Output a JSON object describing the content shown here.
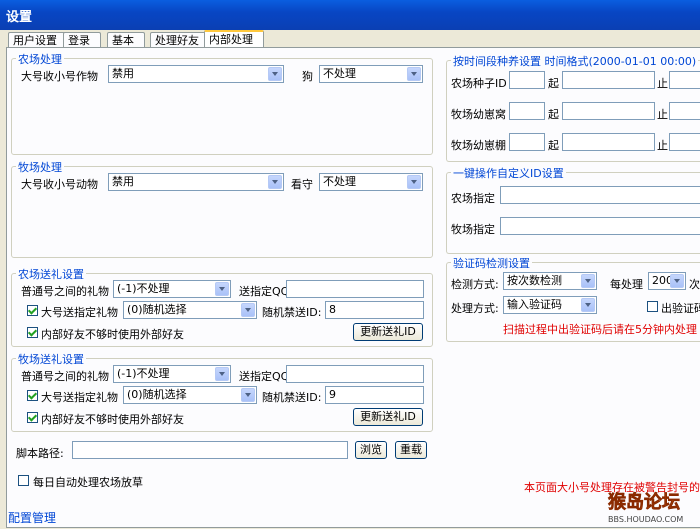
{
  "window": {
    "title": "设置"
  },
  "tabs": [
    "用户设置",
    "登录",
    "基本",
    "处理好友",
    "内部处理"
  ],
  "farm": {
    "title": "农场处理",
    "harvest_label": "大号收小号作物",
    "harvest_value": "禁用",
    "dog_label": "狗",
    "dog_value": "不处理"
  },
  "ranch": {
    "title": "牧场处理",
    "harvest_label": "大号收小号动物",
    "harvest_value": "禁用",
    "guard_label": "看守",
    "guard_value": "不处理"
  },
  "farm_gift": {
    "title": "农场送礼设置",
    "normal_label": "普通号之间的礼物",
    "normal_value": "(-1)不处理",
    "send_to_label": "送指定QQ",
    "send_to_value": "",
    "big_gift_label": "大号送指定礼物",
    "big_gift_value": "(0)随机选择",
    "random_ban_label": "随机禁送ID:",
    "random_ban_value": "8",
    "external_label": "内部好友不够时使用外部好友",
    "update_button": "更新送礼ID"
  },
  "ranch_gift": {
    "title": "牧场送礼设置",
    "normal_label": "普通号之间的礼物",
    "normal_value": "(-1)不处理",
    "send_to_label": "送指定QQ",
    "send_to_value": "",
    "big_gift_label": "大号送指定礼物",
    "big_gift_value": "(0)随机选择",
    "random_ban_label": "随机禁送ID:",
    "random_ban_value": "9",
    "external_label": "内部好友不够时使用外部好友",
    "update_button": "更新送礼ID"
  },
  "script": {
    "path_label": "脚本路径:",
    "path_value": "",
    "browse_button": "浏览",
    "reload_button": "重载"
  },
  "auto_grass": {
    "label": "每日自动处理农场放草"
  },
  "time_segment": {
    "title": "按时间段种养设置 时间格式(2000-01-01 00:00)",
    "rows": [
      {
        "label": "农场种子ID",
        "from": "起",
        "to": "止"
      },
      {
        "label": "牧场幼崽窝",
        "from": "起",
        "to": "止"
      },
      {
        "label": "牧场幼崽棚",
        "from": "起",
        "to": "止"
      }
    ]
  },
  "one_click": {
    "title": "一键操作自定义ID设置",
    "farm_label": "农场指定",
    "ranch_label": "牧场指定"
  },
  "captcha": {
    "title": "验证码检测设置",
    "detect_label": "检测方式:",
    "detect_value": "按次数检测",
    "per_label": "每处理",
    "per_value": "200",
    "per_unit": "次",
    "handle_label": "处理方式:",
    "handle_value": "输入验证码",
    "show_captcha_label": "出验证码",
    "warning": "扫描过程中出验证码后请在5分钟内处理"
  },
  "bottom_warning": "本页面大小号处理存在被警告封号的",
  "status_text": "配置管理",
  "watermark": {
    "text": "猴岛论坛",
    "sub": "BBS.HOUDAO.COM"
  },
  "colors": {
    "accent": "#0046d5",
    "warning": "#e00000"
  }
}
